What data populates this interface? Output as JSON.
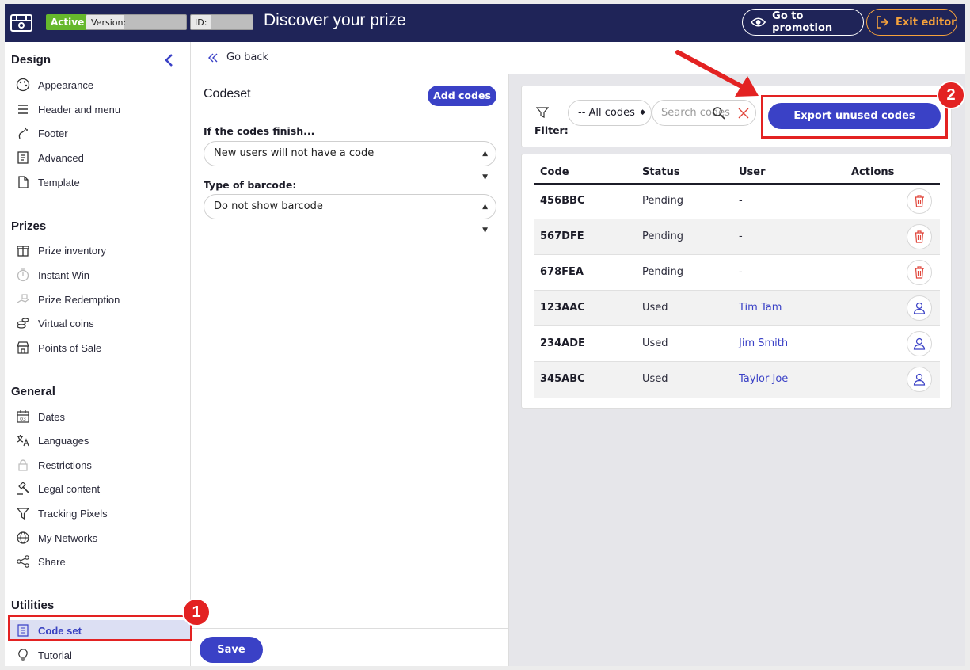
{
  "header": {
    "status": "Active",
    "version_label": "Version:",
    "id_label": "ID:",
    "title": "Discover your prize",
    "goto_label": "Go to promotion",
    "exit_label": "Exit editor"
  },
  "sidebar": {
    "sections": [
      {
        "title": "Design",
        "items": [
          "Appearance",
          "Header and menu",
          "Footer",
          "Advanced",
          "Template"
        ]
      },
      {
        "title": "Prizes",
        "items": [
          "Prize inventory",
          "Instant Win",
          "Prize Redemption",
          "Virtual coins",
          "Points of Sale"
        ]
      },
      {
        "title": "General",
        "items": [
          "Dates",
          "Languages",
          "Restrictions",
          "Legal content",
          "Tracking Pixels",
          "My Networks",
          "Share"
        ]
      },
      {
        "title": "Utilities",
        "items": [
          "Code set",
          "Tutorial"
        ]
      }
    ],
    "active_item": "Code set"
  },
  "goback_label": "Go back",
  "codeset": {
    "title": "Codeset",
    "add_label": "Add codes",
    "finish_label": "If the codes finish...",
    "finish_value": "New users will not have a code",
    "barcode_label": "Type of barcode:",
    "barcode_value": "Do not show barcode",
    "save_label": "Save"
  },
  "filter": {
    "label": "Filter:",
    "select_value": "-- All codes",
    "search_placeholder": "Search codes",
    "export_label": "Export unused codes"
  },
  "table": {
    "headers": [
      "Code",
      "Status",
      "User",
      "Actions"
    ],
    "rows": [
      {
        "code": "456BBC",
        "status": "Pending",
        "user": "-",
        "action": "trash-icon"
      },
      {
        "code": "567DFE",
        "status": "Pending",
        "user": "-",
        "action": "trash-icon"
      },
      {
        "code": "678FEA",
        "status": "Pending",
        "user": "-",
        "action": "trash-icon"
      },
      {
        "code": "123AAC",
        "status": "Used",
        "user": "Tim Tam",
        "action": "user-icon"
      },
      {
        "code": "234ADE",
        "status": "Used",
        "user": "Jim Smith",
        "action": "user-icon"
      },
      {
        "code": "345ABC",
        "status": "Used",
        "user": "Taylor Joe",
        "action": "user-icon"
      }
    ]
  },
  "annotations": {
    "step1": "1",
    "step2": "2"
  },
  "colors": {
    "topbar": "#1f2458",
    "accent": "#3a41c6",
    "active_badge": "#66b82c",
    "exit": "#f5a23c",
    "highlight": "#e32222"
  }
}
